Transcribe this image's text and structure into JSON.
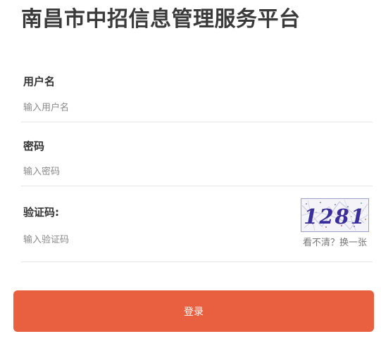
{
  "page": {
    "title": "南昌市中招信息管理服务平台"
  },
  "form": {
    "username": {
      "label": "用户名",
      "placeholder": "输入用户名",
      "value": ""
    },
    "password": {
      "label": "密码",
      "placeholder": "输入密码",
      "value": ""
    },
    "captcha": {
      "label": "验证码:",
      "placeholder": "输入验证码",
      "value": "",
      "image_text": "1281",
      "refresh_label": "看不清？换一张"
    },
    "submit_label": "登录"
  },
  "colors": {
    "accent": "#e8603f",
    "captcha_digits": "#3a2f9a",
    "captcha_border": "#9aa0c8"
  }
}
